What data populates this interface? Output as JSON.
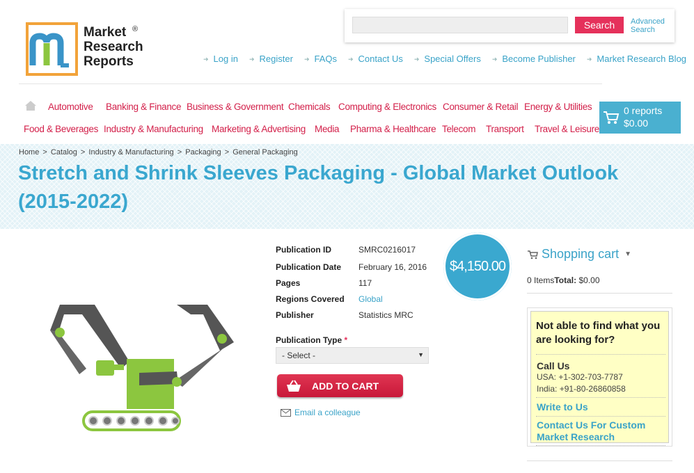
{
  "logo": {
    "line1": "Market",
    "line2": "Research",
    "line3": "Reports",
    "reg": "®"
  },
  "search": {
    "placeholder": "",
    "button": "Search",
    "advanced_line1": "Advanced",
    "advanced_line2": "Search"
  },
  "toplinks": [
    "Log in",
    "Register",
    "FAQs",
    "Contact Us",
    "Special Offers",
    "Become Publisher",
    "Market Research Blog"
  ],
  "categories_row1": [
    "Automotive",
    "Banking & Finance",
    "Business & Government",
    "Chemicals",
    "Computing & Electronics",
    "Consumer & Retail",
    "Energy & Utilities"
  ],
  "categories_row2": [
    "Food & Beverages",
    "Industry & Manufacturing",
    "Marketing & Advertising",
    "Media",
    "Pharma & Healthcare",
    "Telecom",
    "Transport",
    "Travel & Leisure"
  ],
  "cart_box": {
    "reports": "0 reports",
    "amount": "$0.00"
  },
  "breadcrumb": [
    "Home",
    "Catalog",
    "Industry & Manufacturing",
    "Packaging",
    "General Packaging"
  ],
  "breadcrumb_sep": ">",
  "title": "Stretch and Shrink Sleeves Packaging - Global Market Outlook (2015-2022)",
  "details": {
    "publication_id_label": "Publication ID",
    "publication_id": "SMRC0216017",
    "publication_date_label": "Publication Date",
    "publication_date": "February 16, 2016",
    "pages_label": "Pages",
    "pages": "117",
    "regions_label": "Regions Covered",
    "regions": "Global",
    "publisher_label": "Publisher",
    "publisher": "Statistics MRC"
  },
  "price": "$4,150.00",
  "publication_type": {
    "label": "Publication Type",
    "required": "*",
    "selected": "- Select -"
  },
  "add_to_cart": "ADD TO CART",
  "email_colleague": "Email a colleague",
  "shopping_cart": {
    "title": "Shopping cart",
    "items": "0 Items",
    "total_label": "Total:",
    "total": "$0.00"
  },
  "help": {
    "question": "Not able to find what you are looking for?",
    "call_us": "Call Us",
    "usa": "USA: +1-302-703-7787",
    "india": "India: +91-80-26860858",
    "write": "Write to Us",
    "custom": "Contact Us For Custom Market Research"
  },
  "colors": {
    "accent_blue": "#3aa7cf",
    "accent_red": "#d3204a",
    "cart_blue": "#4ab0d0",
    "help_yellow": "#ffffc5"
  }
}
